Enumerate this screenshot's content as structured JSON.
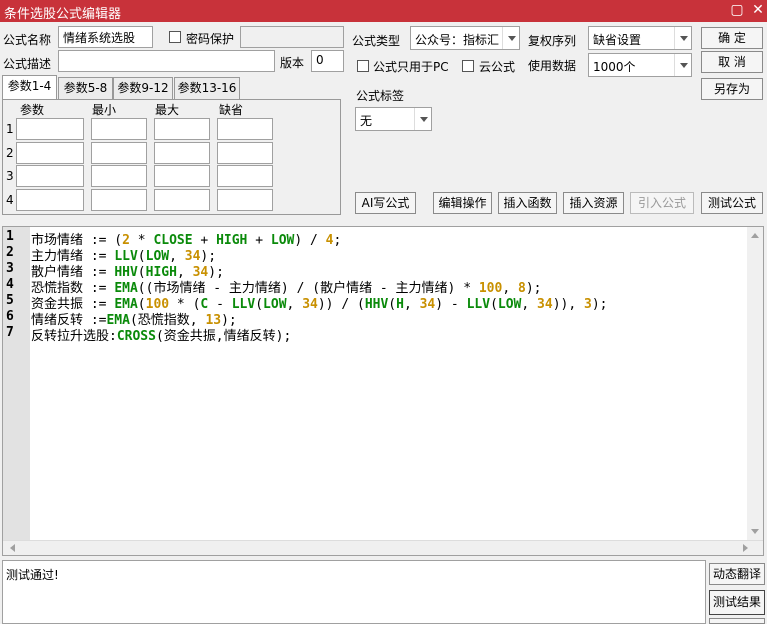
{
  "window": {
    "title": "条件选股公式编辑器",
    "minimize": "▢",
    "close": "✕"
  },
  "form": {
    "name_label": "公式名称",
    "name_value": "情绪系统选股",
    "password_label": "密码保护",
    "desc_label": "公式描述",
    "desc_value": "",
    "version_label": "版本",
    "version_value": "0",
    "type_label": "公式类型",
    "type_value": "公众号：指标汇",
    "pc_only_label": "公式只用于PC",
    "cloud_label": "云公式",
    "adjust_label": "复权序列",
    "adjust_value": "缺省设置",
    "data_label": "使用数据",
    "data_value": "1000个",
    "tag_label": "公式标签",
    "tag_value": "无"
  },
  "buttons": {
    "ok": "确  定",
    "cancel": "取  消",
    "save_as": "另存为",
    "ai_write": "AI写公式",
    "edit_op": "编辑操作",
    "insert_func": "插入函数",
    "insert_res": "插入资源",
    "import": "引入公式",
    "test": "测试公式"
  },
  "tabs": [
    "参数1-4",
    "参数5-8",
    "参数9-12",
    "参数13-16"
  ],
  "params": {
    "headers": [
      "参数",
      "最小",
      "最大",
      "缺省"
    ],
    "rows": [
      "1",
      "2",
      "3",
      "4"
    ]
  },
  "code_lines": [
    {
      "num": "1",
      "text": "市场情绪 := (2 * CLOSE + HIGH + LOW) / 4;"
    },
    {
      "num": "2",
      "text": "主力情绪 := LLV(LOW, 34);"
    },
    {
      "num": "3",
      "text": "散户情绪 := HHV(HIGH, 34);"
    },
    {
      "num": "4",
      "text": "恐慌指数 := EMA((市场情绪 - 主力情绪) / (散户情绪 - 主力情绪) * 100, 8);"
    },
    {
      "num": "5",
      "text": "资金共振 := EMA(100 * (C - LLV(LOW, 34)) / (HHV(H, 34) - LLV(LOW, 34)), 3);"
    },
    {
      "num": "6",
      "text": "情绪反转 :=EMA(恐慌指数, 13);"
    },
    {
      "num": "7",
      "text": "反转拉升选股:CROSS(资金共振,情绪反转);"
    }
  ],
  "output": {
    "text": "测试通过!"
  },
  "side_buttons": [
    "动态翻译",
    "测试结果"
  ]
}
